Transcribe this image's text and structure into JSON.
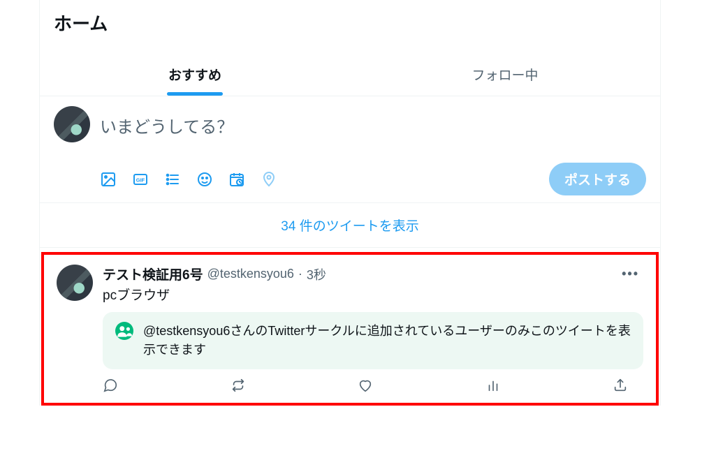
{
  "header": {
    "title": "ホーム"
  },
  "tabs": {
    "recommended": "おすすめ",
    "following": "フォロー中"
  },
  "composer": {
    "placeholder": "いまどうしてる？",
    "post_button": "ポストする"
  },
  "show_more": "34 件のツイートを表示",
  "tweet": {
    "display_name": "テスト検証用6号",
    "handle": "@testkensyou6",
    "separator": "·",
    "time": "3秒",
    "text": "pcブラウザ",
    "circle_notice": "@testkensyou6さんのTwitterサークルに追加されているユーザーのみこのツイートを表示できます"
  },
  "colors": {
    "accent": "#1d9bf0",
    "accent_muted": "#8ecdf7",
    "circle_green": "#00ba7c",
    "highlight_border": "#ff0000"
  }
}
